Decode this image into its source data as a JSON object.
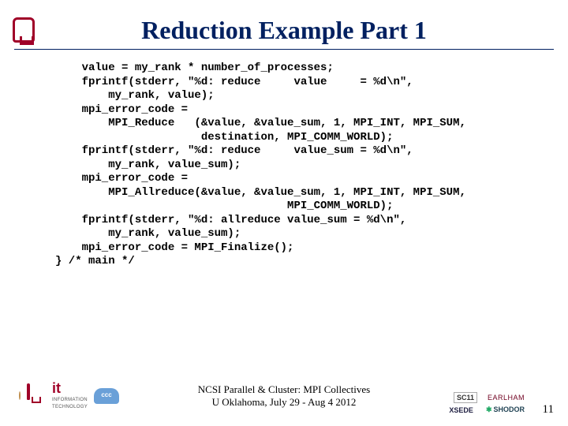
{
  "title": "Reduction Example Part 1",
  "code": "    value = my_rank * number_of_processes;\n    fprintf(stderr, \"%d: reduce     value     = %d\\n\",\n        my_rank, value);\n    mpi_error_code =\n        MPI_Reduce   (&value, &value_sum, 1, MPI_INT, MPI_SUM,\n                      destination, MPI_COMM_WORLD);\n    fprintf(stderr, \"%d: reduce     value_sum = %d\\n\",\n        my_rank, value_sum);\n    mpi_error_code =\n        MPI_Allreduce(&value, &value_sum, 1, MPI_INT, MPI_SUM,\n                                   MPI_COMM_WORLD);\n    fprintf(stderr, \"%d: allreduce value_sum = %d\\n\",\n        my_rank, value_sum);\n    mpi_error_code = MPI_Finalize();\n} /* main */",
  "footer": {
    "line1": "NCSI Parallel & Cluster: MPI Collectives",
    "line2": "U Oklahoma, July 29 - Aug 4 2012"
  },
  "logos": {
    "ou": "OU",
    "it_big": "it",
    "it_text": "INFORMATION",
    "it_text2": "TECHNOLOGY",
    "ccc": "ccc",
    "sc11": "SC11",
    "earlham": "EARLHAM",
    "xsede": "XSEDE",
    "shodor": "SHODOR"
  },
  "page_number": "11"
}
